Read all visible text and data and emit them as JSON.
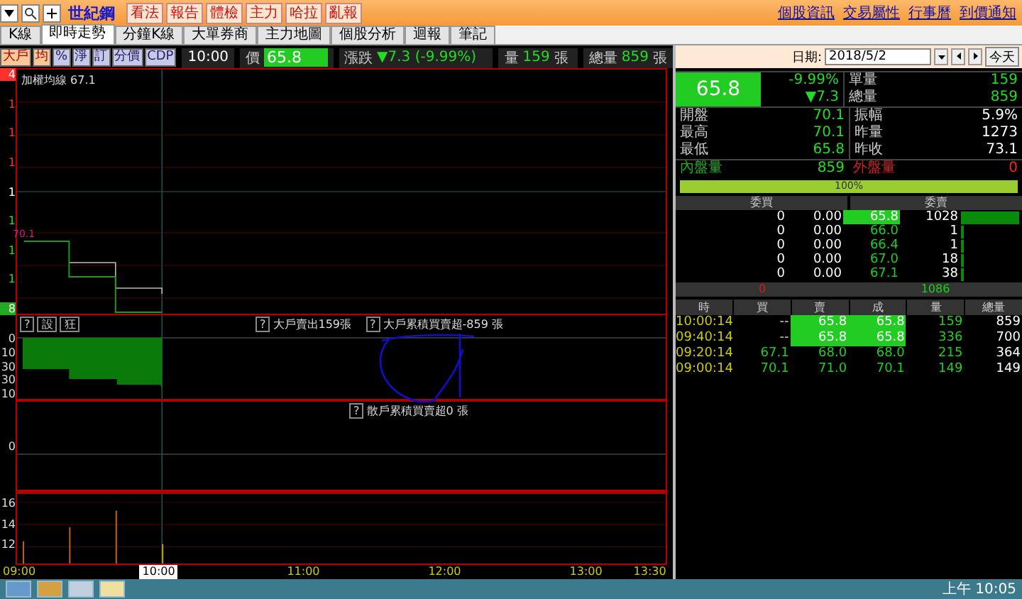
{
  "top_bar": {
    "stock_name": "世紀鋼",
    "menu_buttons": [
      "看法",
      "報告",
      "體檢",
      "主力",
      "哈拉",
      "亂報"
    ],
    "links": [
      "個股資訊",
      "交易屬性",
      "行事曆",
      "到價通知"
    ]
  },
  "tabs": [
    {
      "label": "K線",
      "selected": false
    },
    {
      "label": "即時走勢",
      "selected": true
    },
    {
      "label": "分鐘K線",
      "selected": false
    },
    {
      "label": "大單券商",
      "selected": false
    },
    {
      "label": "主力地圖",
      "selected": false
    },
    {
      "label": "個股分析",
      "selected": false
    },
    {
      "label": "迴報",
      "selected": false
    },
    {
      "label": "筆記",
      "selected": false
    }
  ],
  "toolbar": {
    "buttons": [
      {
        "label": "大戶",
        "selected": true
      },
      {
        "label": "均",
        "selected": true
      },
      {
        "label": "%",
        "selected": false
      },
      {
        "label": "淨",
        "selected": false
      },
      {
        "label": "訂",
        "selected": false
      },
      {
        "label": "分價",
        "selected": false
      },
      {
        "label": "CDP",
        "selected": false
      }
    ],
    "time": "10:00",
    "price_label": "價",
    "price": "65.8",
    "change_label": "漲跌",
    "change": "▼7.3 (-9.99%)",
    "volume_label": "量",
    "volume": "159",
    "volume_unit": "張",
    "total_label": "總量",
    "total": "859",
    "total_unit": "張"
  },
  "price_chart": {
    "average_label": "加權均線 67.1",
    "ref_label": "70.1",
    "axis_labels": [
      {
        "text": "4",
        "kind": "box",
        "color": "#ff3030"
      },
      {
        "text": "1",
        "kind": "plain",
        "color": "#ff3030"
      },
      {
        "text": "1",
        "kind": "plain",
        "color": "#ff3030"
      },
      {
        "text": "1",
        "kind": "plain",
        "color": "#ff3030"
      },
      {
        "text": "1",
        "kind": "plain",
        "color": "#ffffff"
      },
      {
        "text": "1",
        "kind": "plain",
        "color": "#22dd22"
      },
      {
        "text": "1",
        "kind": "plain",
        "color": "#22dd22"
      },
      {
        "text": "1",
        "kind": "plain",
        "color": "#22dd22"
      },
      {
        "text": "8",
        "kind": "box",
        "color": "#22aa22"
      }
    ]
  },
  "big_trader_panel": {
    "buttons": [
      "?",
      "設",
      "狂"
    ],
    "notes": [
      {
        "icon": "?",
        "text": "大戶賣出159張"
      },
      {
        "icon": "?",
        "text": "大戶累積買賣超-859 張"
      }
    ],
    "axis_labels": [
      "0",
      "10",
      "30",
      "30",
      "10"
    ]
  },
  "retail_panel": {
    "notes": [
      {
        "icon": "?",
        "text": "散戶累積買賣超0 張"
      }
    ],
    "axis_labels": [
      "0"
    ]
  },
  "volume_panel": {
    "axis_labels": [
      "16",
      "14",
      "12"
    ]
  },
  "time_axis": [
    {
      "label": "09:00",
      "selected": false
    },
    {
      "label": "10:00",
      "selected": true
    },
    {
      "label": "11:00",
      "selected": false
    },
    {
      "label": "12:00",
      "selected": false
    },
    {
      "label": "13:00",
      "selected": false
    },
    {
      "label": "13:30",
      "selected": false
    }
  ],
  "date_bar": {
    "label": "日期:",
    "date": "2018/5/2",
    "today_button": "今天"
  },
  "quote": {
    "price": "65.8",
    "change_percent": "-9.99%",
    "change": "▼7.3",
    "side_rows": [
      {
        "label": "單量",
        "value": "159"
      },
      {
        "label": "總量",
        "value": "859"
      }
    ],
    "rows": [
      {
        "label": "開盤",
        "value": "70.1",
        "label2": "振幅",
        "value2": "5.9%"
      },
      {
        "label": "最高",
        "value": "70.1",
        "label2": "昨量",
        "value2": "1273"
      },
      {
        "label": "最低",
        "value": "65.8",
        "label2": "昨收",
        "value2": "73.1"
      }
    ],
    "inner_label": "內盤量",
    "inner_value": "859",
    "outer_label": "外盤量",
    "outer_value": "0"
  },
  "ratio_bar": {
    "text": "100%",
    "level": 1
  },
  "order_book": {
    "bid_header": "委買",
    "ask_header": "委賣",
    "rows": [
      {
        "bid_volume": "0",
        "bid_price": "0.00",
        "ask_price": "65.8",
        "ask_volume": "1028",
        "highlight": true
      },
      {
        "bid_volume": "0",
        "bid_price": "0.00",
        "ask_price": "66.0",
        "ask_volume": "1",
        "highlight": false
      },
      {
        "bid_volume": "0",
        "bid_price": "0.00",
        "ask_price": "66.4",
        "ask_volume": "1",
        "highlight": false
      },
      {
        "bid_volume": "0",
        "bid_price": "0.00",
        "ask_price": "67.0",
        "ask_volume": "18",
        "highlight": false
      },
      {
        "bid_volume": "0",
        "bid_price": "0.00",
        "ask_price": "67.1",
        "ask_volume": "38",
        "highlight": false
      }
    ],
    "bid_total": "0",
    "ask_total": "1086"
  },
  "ticks": {
    "columns": [
      "時",
      "買",
      "賣",
      "成",
      "量",
      "總量"
    ],
    "rows": [
      {
        "time": "10:00:14",
        "bid": "--",
        "ask": "65.8",
        "deal": "65.8",
        "volume": "159",
        "total": "859",
        "highlight": true
      },
      {
        "time": "09:40:14",
        "bid": "--",
        "ask": "65.8",
        "deal": "65.8",
        "volume": "336",
        "total": "700",
        "highlight": true
      },
      {
        "time": "09:20:14",
        "bid": "67.1",
        "ask": "68.0",
        "deal": "68.0",
        "volume": "215",
        "total": "364",
        "highlight": false
      },
      {
        "time": "09:00:14",
        "bid": "70.1",
        "ask": "71.0",
        "deal": "70.1",
        "volume": "149",
        "total": "149",
        "highlight": false
      }
    ]
  },
  "taskbar": {
    "clock": "上午 10:05"
  }
}
